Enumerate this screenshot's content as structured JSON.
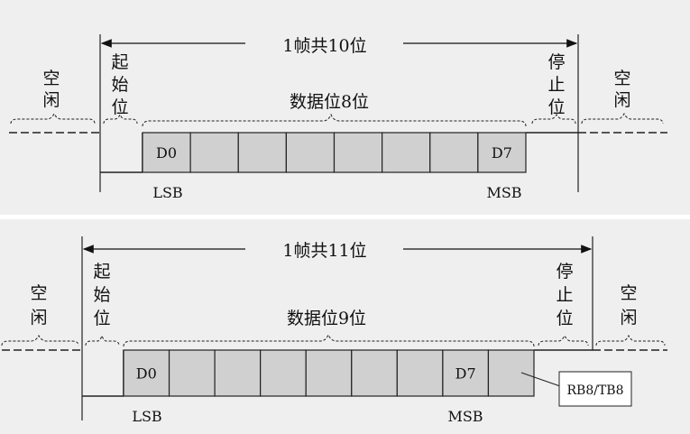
{
  "colors": {
    "panel_bg": "#efefef",
    "separator": "#ffffff",
    "bit_fill": "#d0d0d0",
    "stroke": "#222222",
    "text": "#111111"
  },
  "frames": [
    {
      "frame_label": "1帧共10位",
      "idle_left": [
        "空",
        "闲"
      ],
      "start_bit": [
        "起",
        "始",
        "位"
      ],
      "data_label": "数据位8位",
      "stop_bit": [
        "停",
        "止",
        "位"
      ],
      "idle_right": [
        "空",
        "闲"
      ],
      "bits": [
        "D0",
        "",
        "",
        "",
        "",
        "",
        "",
        "D7"
      ],
      "lsb": "LSB",
      "msb": "MSB"
    },
    {
      "frame_label": "1帧共11位",
      "idle_left": [
        "空",
        "闲"
      ],
      "start_bit": [
        "起",
        "始",
        "位"
      ],
      "data_label": "数据位9位",
      "stop_bit": [
        "停",
        "止",
        "位"
      ],
      "idle_right": [
        "空",
        "闲"
      ],
      "bits": [
        "D0",
        "",
        "",
        "",
        "",
        "",
        "",
        "D7",
        ""
      ],
      "lsb": "LSB",
      "msb": "MSB",
      "callout": "RB8/TB8"
    }
  ]
}
